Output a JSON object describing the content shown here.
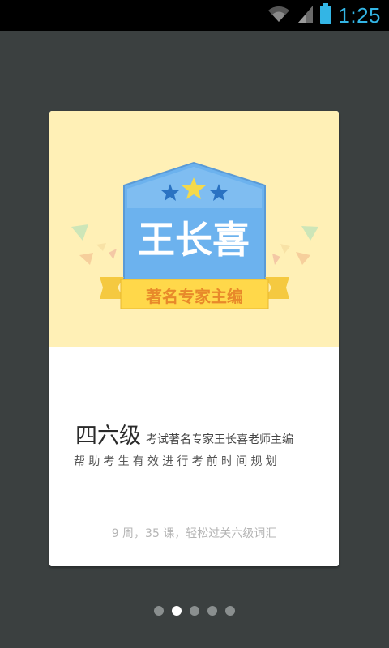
{
  "status_bar": {
    "time": "1:25",
    "icons": [
      "wifi-icon",
      "signal-icon",
      "battery-icon"
    ],
    "accent_color": "#33b5e5"
  },
  "card": {
    "illustration": {
      "name_on_badge": "王长喜",
      "ribbon_text": "著名专家主编",
      "background_color": "#fff0b6",
      "badge_color": "#6cb2ee"
    },
    "headline_main": "四六级",
    "headline_sub": "考试著名专家王长喜老师主编",
    "tagline": "帮助考生有效进行考前时间规划",
    "foot_note": "9 周，35 课，轻松过关六级词汇"
  },
  "pager": {
    "total": 5,
    "active_index": 1
  }
}
